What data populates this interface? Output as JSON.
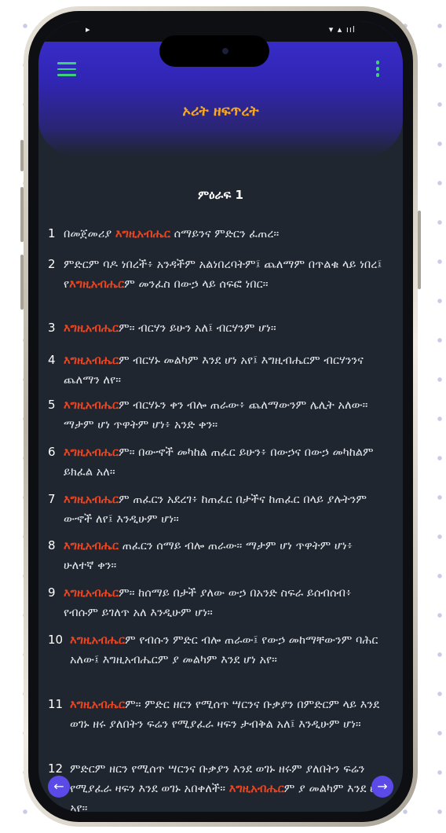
{
  "app": {
    "title": "ኦሪት ዘፍጥረት",
    "chapter_title": "ምዕራፍ 1"
  },
  "status_bar": {
    "left": "▸",
    "right": "▾ ▴ ııl"
  },
  "icons": {
    "menu": "menu-icon",
    "more": "more-vert-icon",
    "prev": "arrow-left-icon",
    "next": "arrow-right-icon"
  },
  "colors": {
    "accent": "#f5a623",
    "highlight": "#f0441f",
    "icon_green": "#3fd07a",
    "header": "#3a2fd0",
    "background": "#1f2630"
  },
  "verses": [
    {
      "num": "1",
      "pre": "በመጀመሪያ ",
      "god": "እግዚአብሔር",
      "post": " ሰማይንና ምድርን ፈጠረ።"
    },
    {
      "num": "2",
      "pre": "ምድርም ባዶ ነበረች፥ አንዳችም አልነበረባትም፤ ጨለማም በጥልቁ ላይ ነበረ፤ የ",
      "god": "እግዚአብሔር",
      "post": "ም መንፈስ በውኃ ላይ ሰፍፎ ነበር።"
    },
    {
      "num": "3",
      "pre": "",
      "god": "እግዚአብሔር",
      "post": "ም። ብርሃን ይሁን አለ፤ ብርሃንም ሆነ።"
    },
    {
      "num": "4",
      "pre": "",
      "god": "እግዚአብሔር",
      "post": "ም ብርሃኑ መልካም እንደ ሆነ አየ፤ እግዚብሔርም ብርሃንንና ጨለማን ለየ።"
    },
    {
      "num": "5",
      "pre": "",
      "god": "እግዚአብሔር",
      "post": "ም ብርሃኑን ቀን ብሎ ጠራው፥ ጨለማውንም ሌሊት አለው። ማታም ሆነ ጥዋትም ሆነ፥ አንድ ቀን።"
    },
    {
      "num": "6",
      "pre": "",
      "god": "እግዚአብሔር",
      "post": "ም። በውኆች መካከል ጠፈር ይሁን፥ በውኃና በውኃ መካከልም ይክፈል አለ።"
    },
    {
      "num": "7",
      "pre": "",
      "god": "እግዚአብሔር",
      "post": "ም ጠፈርን አደረገ፥ ከጠፈር በታችና ከጠፈር በላይ ያሉትንም ውኆች ለየ፤ እንዲሁም ሆነ።"
    },
    {
      "num": "8",
      "pre": "",
      "god": "እግዚአብሔር",
      "post": " ጠፈርን ሰማይ ብሎ ጠራው። ማታም ሆነ ጥዋትም ሆነ፥ ሁለተኛ ቀን።"
    },
    {
      "num": "9",
      "pre": "",
      "god": "እግዚአብሔር",
      "post": "ም። ከሰማይ በታች ያለው ውኃ በአንድ ስፍራ ይሰብሰብ፥ የብሱም ይገለጥ አለ እንዲሁም ሆነ።"
    },
    {
      "num": "10",
      "pre": "",
      "god": "እግዚአብሔር",
      "post": "ም የብሱን ምድር ብሎ ጠራው፤ የውኃ መከማቸውንም ባሕር አለው፤ እግዚአብሔርም ያ መልካም እንደ ሆነ አየ።"
    },
    {
      "num": "11",
      "pre": "",
      "god": "እግዚአብሔር",
      "post": "ም። ምድር ዘርን የሚሰጥ ሣርንና ቡቃያን በምድርም ላይ እንደ ወገኑ ዘሩ ያለበትን ፍሬን የሚያፈራ ዛፍን ታብቅል አለ፤ እንዲሁም ሆነ።"
    },
    {
      "num": "12",
      "pre": "ምድርም ዘርን የሚሰጥ ሣርንና ቡቃያን እንደ ወገኑ ዘሩም ያለበትን ፍሬን የሚያፈራ ዛፍን እንደ ወገኑ አበቀለች። ",
      "god": "እግዚአብሔር",
      "post": "ም ያ መልካም እንደ ሆነ አየ።"
    }
  ]
}
